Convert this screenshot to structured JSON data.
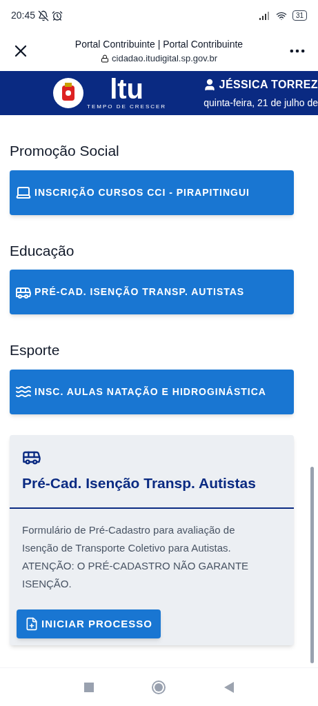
{
  "status_bar": {
    "time": "20:45",
    "battery": "31"
  },
  "browser": {
    "title": "Portal Contribuinte | Portal Contribuinte",
    "url": "cidadao.itudigital.sp.gov.br"
  },
  "header": {
    "logo_text": "ltu",
    "logo_tagline": "TEMPO DE CRESCER",
    "user": "JÉSSICA TORREZ",
    "date": "quinta-feira, 21 de julho de"
  },
  "sections": [
    {
      "title": "Promoção Social",
      "buttons": [
        {
          "kind": "computer",
          "label": "INSCRIÇÃO CURSOS CCI - PIRAPITINGUI"
        }
      ]
    },
    {
      "title": "Educação",
      "buttons": [
        {
          "kind": "bus",
          "label": "PRÉ-CAD. ISENÇÃO TRANSP. AUTISTAS"
        }
      ]
    },
    {
      "title": "Esporte",
      "buttons": [
        {
          "kind": "swim",
          "label": "INSC. AULAS NATAÇÃO E HIDROGINÁSTICA"
        }
      ]
    }
  ],
  "card": {
    "kind": "bus",
    "title": "Pré-Cad. Isenção Transp. Autistas",
    "description": "Formulário de Pré-Cadastro para avaliação de Isenção de Transporte Coletivo para Autistas. ATENÇÃO: O PRÉ-CADASTRO NÃO GARANTE ISENÇÃO.",
    "action": "INICIAR PROCESSO"
  }
}
